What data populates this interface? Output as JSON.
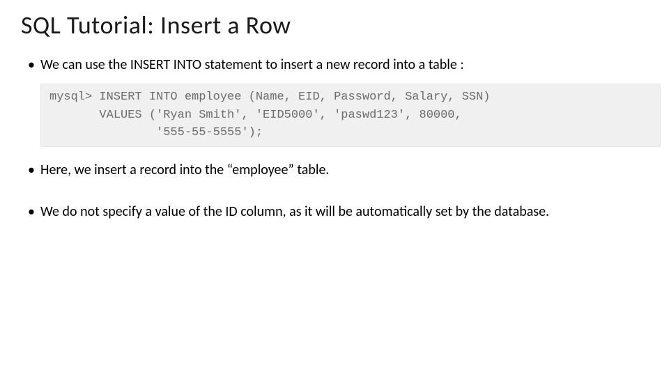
{
  "title": "SQL Tutorial: Insert a Row",
  "bullets": {
    "b1": "We can use the INSERT INTO statement to insert a new record into a table :",
    "b2": "Here, we insert a record into the “employee” table.",
    "b3": "We do not specify a value of the ID column, as it will be automatically set by the database."
  },
  "code": {
    "line1": "mysql> INSERT INTO employee (Name, EID, Password, Salary, SSN)",
    "line2": "       VALUES ('Ryan Smith', 'EID5000', 'paswd123', 80000,",
    "line3": "               '555-55-5555');"
  }
}
